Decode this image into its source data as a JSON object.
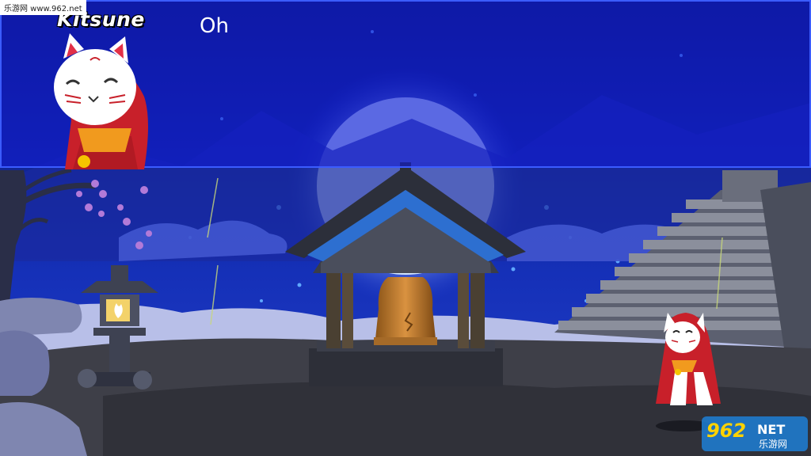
{
  "dialog": {
    "speaker": "Kitsune",
    "text": "Oh"
  },
  "watermark": {
    "top_left": "乐游网 www.962.net",
    "logo_number": "962",
    "logo_suffix": "NET",
    "logo_chinese": "乐游网"
  },
  "icons": {
    "portrait": "kitsune-fox-mask-portrait",
    "player": "kitsune-fox-mask-character",
    "bell": "temple-bell",
    "lantern": "stone-lantern"
  },
  "colors": {
    "sky": "#0c1a6e",
    "moon": "#cfe4ff",
    "dialog_bg": "#121cd2",
    "robe": "#c8202a",
    "bell": "#c9812f",
    "roof_trim": "#2d6fd0"
  }
}
